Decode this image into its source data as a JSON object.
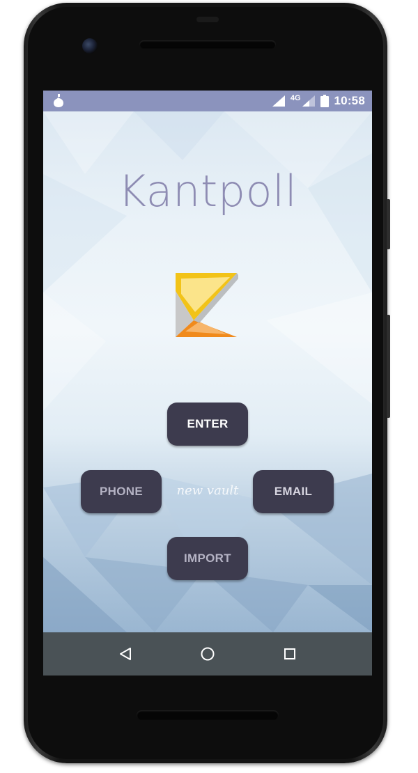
{
  "statusbar": {
    "network_type": "4G",
    "time": "10:58",
    "icons": [
      "drop-icon",
      "signal-icon",
      "signal-icon",
      "battery-icon"
    ]
  },
  "app": {
    "title": "Kantpoll",
    "logo_icon": "kantpoll-logo-icon"
  },
  "actions": {
    "enter_label": "ENTER",
    "phone_label": "PHONE",
    "new_vault_label": "new vault",
    "email_label": "EMAIL",
    "import_label": "IMPORT"
  },
  "navbar": {
    "icons": [
      "back-icon",
      "home-icon",
      "recents-icon"
    ]
  },
  "colors": {
    "statusbar": "#8b93bd",
    "title": "#8e8cb3",
    "button_bg": "#3d3b4e",
    "navbar": "#4a5256"
  }
}
